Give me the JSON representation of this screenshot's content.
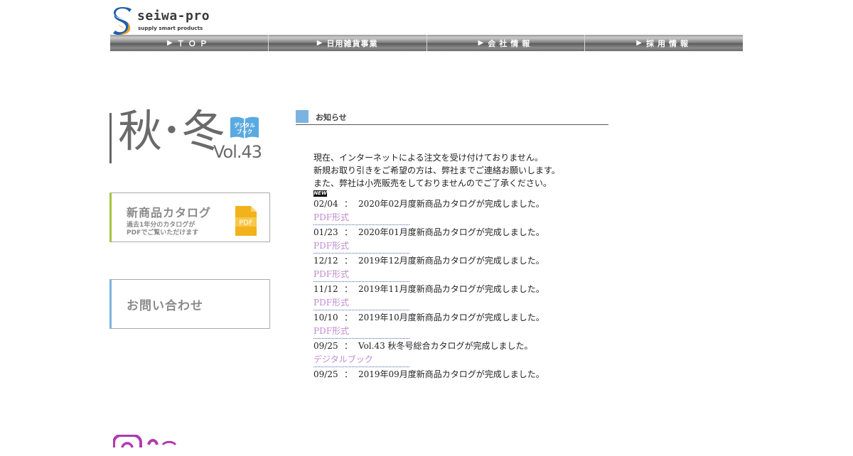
{
  "logo": {
    "name": "seiwa-pro",
    "tagline": "supply smart products",
    "colors": {
      "blue": "#1f5fa8",
      "orange": "#f0a020"
    }
  },
  "nav": {
    "items": [
      {
        "label": "ＴＯＰ"
      },
      {
        "label": "日用雑貨事業"
      },
      {
        "label": "会社情報"
      },
      {
        "label": "採用情報"
      }
    ],
    "arrow": "▶"
  },
  "season_banner": {
    "title": "秋･冬",
    "vol": "Vol.43",
    "badge": "デジタルブック",
    "badge_line1": "デジタル",
    "badge_line2": "ブック"
  },
  "catalog_banner": {
    "title": "新商品カタログ",
    "subtitle_line1": "過去1年分のカタログが",
    "subtitle_line2": "PDFでご覧いただけます",
    "icon_label": "PDF"
  },
  "contact_banner": {
    "title": "お問い合わせ"
  },
  "news": {
    "heading": "お知らせ",
    "notice": [
      "現在、インターネットによる注文を受け付けておりません。",
      "新規お取り引きをご希望の方は、弊社までご連絡お願いします。",
      "また、弊社は小売販売をしておりませんのでご了承ください。"
    ],
    "new_badge": "NEW",
    "colon": "：",
    "items": [
      {
        "date": "02/04",
        "text": "2020年02月度新商品カタログが完成しました。",
        "link": "PDF形式"
      },
      {
        "date": "01/23",
        "text": "2020年01月度新商品カタログが完成しました。",
        "link": "PDF形式"
      },
      {
        "date": "12/12",
        "text": "2019年12月度新商品カタログが完成しました。",
        "link": "PDF形式"
      },
      {
        "date": "11/12",
        "text": "2019年11月度新商品カタログが完成しました。",
        "link": "PDF形式"
      },
      {
        "date": "10/10",
        "text": "2019年10月度新商品カタログが完成しました。",
        "link": "PDF形式"
      },
      {
        "date": "09/25",
        "text": "Vol.43 秋冬号総合カタログが完成しました。",
        "link": "デジタルブック"
      },
      {
        "date": "09/25",
        "text": "2019年09月度新商品カタログが完成しました。",
        "link": ""
      }
    ],
    "colors": {
      "link": "#c08ad0",
      "heading_block": "#7bb3e0"
    }
  }
}
